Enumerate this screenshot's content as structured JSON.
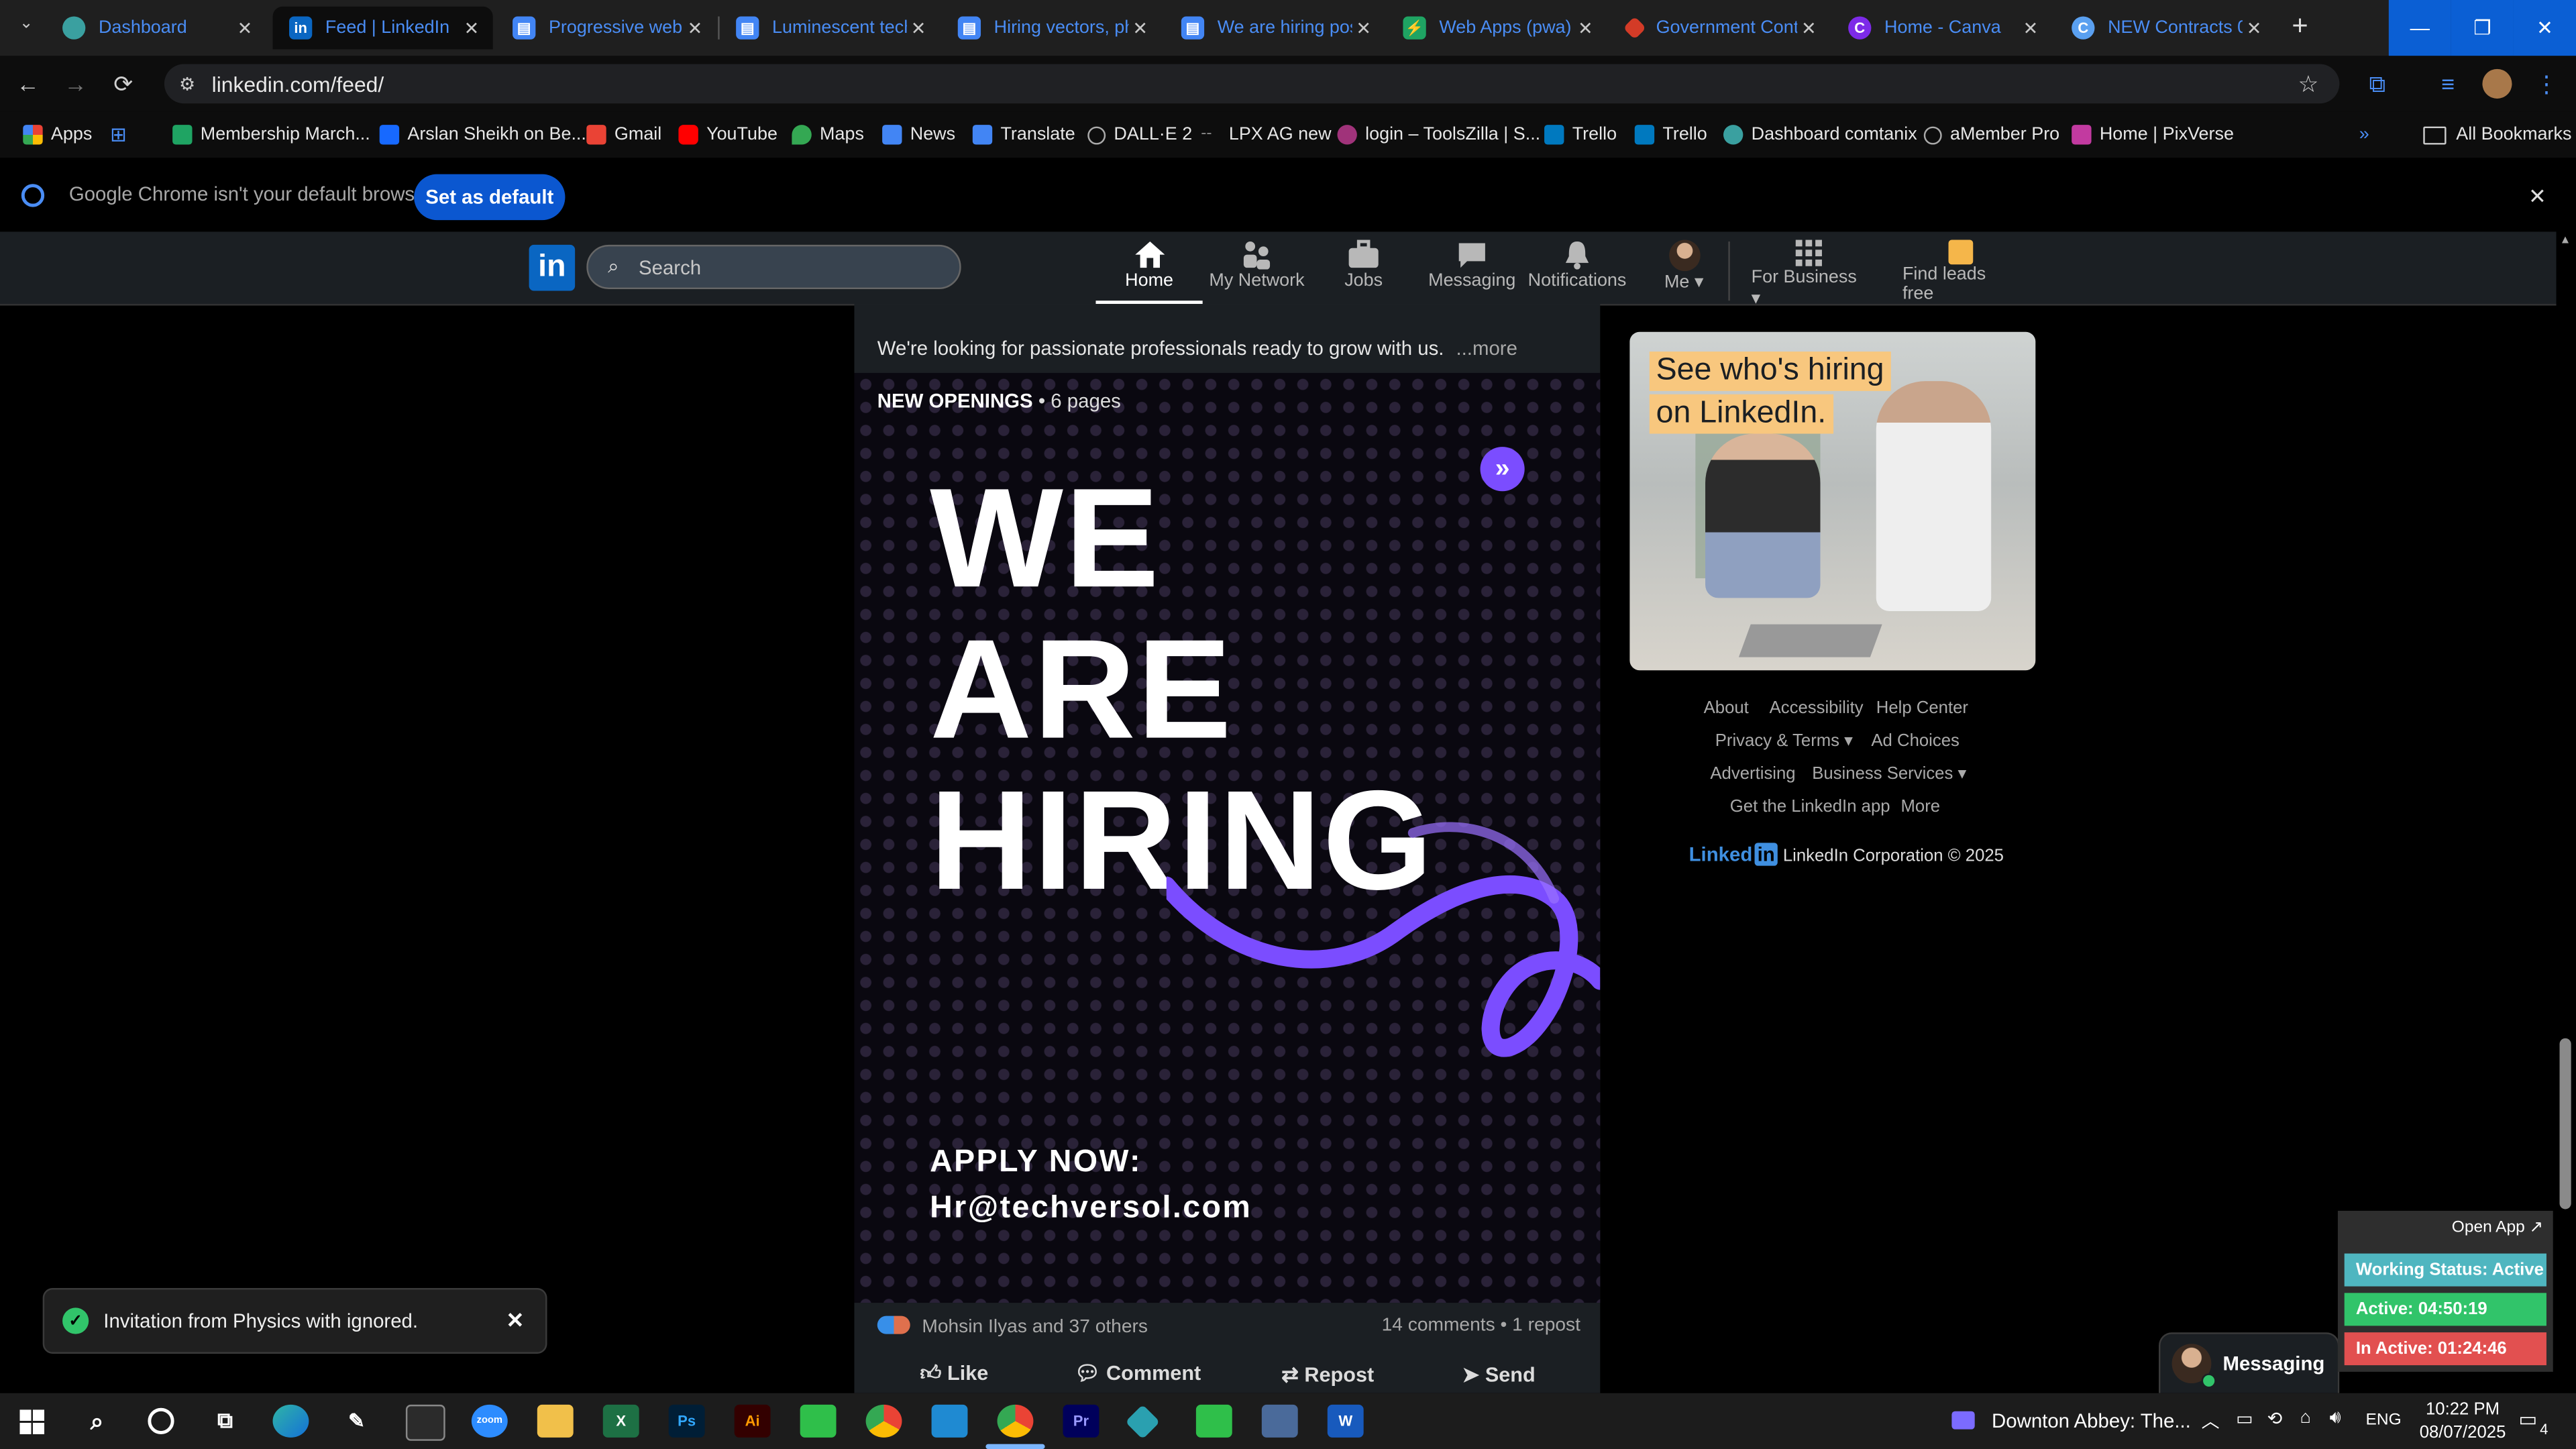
{
  "tabs": [
    {
      "title": "Dashboard",
      "icon": "dashboard-favicon",
      "color": "#3aa0a0"
    },
    {
      "title": "Feed | LinkedIn",
      "icon": "linkedin-favicon",
      "color": "#0a66c2"
    },
    {
      "title": "Progressive web a",
      "icon": "docs-favicon",
      "color": "#4285f4"
    },
    {
      "title": "Luminescent tech",
      "icon": "docs-favicon",
      "color": "#4285f4"
    },
    {
      "title": "Hiring vectors, ph",
      "icon": "docs-favicon",
      "color": "#4285f4"
    },
    {
      "title": "We are hiring pos",
      "icon": "docs-favicon",
      "color": "#4285f4"
    },
    {
      "title": "Web Apps (pwa) I",
      "icon": "sheets-favicon",
      "color": "#1fa463"
    },
    {
      "title": "Government Cont",
      "icon": "gov-favicon",
      "color": "#d33b27"
    },
    {
      "title": "Home - Canva",
      "icon": "canva-favicon",
      "color": "#7d2ae8"
    },
    {
      "title": "NEW Contracts 0",
      "icon": "contracts-favicon",
      "color": "#5aa0f0"
    }
  ],
  "address": "linkedin.com/feed/",
  "bookmarks": [
    {
      "label": "Apps",
      "color": "#e94235"
    },
    {
      "label": "Membership March...",
      "color": "#1fa463"
    },
    {
      "label": "Arslan Sheikh on Be...",
      "color": "#1769ff"
    },
    {
      "label": "Gmail",
      "color": "#ea4335"
    },
    {
      "label": "YouTube",
      "color": "#ff0000"
    },
    {
      "label": "Maps",
      "color": "#34a853"
    },
    {
      "label": "News",
      "color": "#4285f4"
    },
    {
      "label": "Translate",
      "color": "#4285f4"
    },
    {
      "label": "DALL·E 2",
      "color": "#999999"
    },
    {
      "label": "LPX AG new",
      "color": "#666666"
    },
    {
      "label": "login – ToolsZilla | S...",
      "color": "#a0337a"
    },
    {
      "label": "Trello",
      "color": "#0079bf"
    },
    {
      "label": "Trello",
      "color": "#0079bf"
    },
    {
      "label": "Dashboard comtanix",
      "color": "#3aa0a0"
    },
    {
      "label": "aMember Pro",
      "color": "#888888"
    },
    {
      "label": "Home | PixVerse",
      "color": "#c23aa0"
    }
  ],
  "all_bookmarks": "All Bookmarks",
  "infobar": {
    "message": "Google Chrome isn't your default browser",
    "button": "Set as default"
  },
  "linkedin": {
    "search_placeholder": "Search",
    "nav": [
      {
        "label": "Home",
        "icon": "home-icon"
      },
      {
        "label": "My Network",
        "icon": "network-icon"
      },
      {
        "label": "Jobs",
        "icon": "briefcase-icon"
      },
      {
        "label": "Messaging",
        "icon": "chat-icon"
      },
      {
        "label": "Notifications",
        "icon": "bell-icon"
      },
      {
        "label": "Me",
        "icon": "avatar"
      },
      {
        "label": "For Business",
        "icon": "grid-icon"
      },
      {
        "label": "Find leads free",
        "icon": "leads-icon"
      }
    ],
    "post": {
      "text": "We're looking for passionate professionals ready to grow with us.",
      "more": "...more",
      "doc_title": "NEW OPENINGS",
      "doc_pages": "• 6 pages",
      "headline": [
        "WE",
        "ARE",
        "HIRING"
      ],
      "apply": "APPLY NOW:",
      "email": "Hr@techversol.com",
      "reactions": "Mohsin Ilyas and 37 others",
      "comments": "14 comments • 1 repost",
      "actions": [
        "Like",
        "Comment",
        "Repost",
        "Send"
      ]
    },
    "ad": {
      "line1": "See who's hiring",
      "line2": "on LinkedIn."
    },
    "footer": {
      "about": "About",
      "accessibility": "Accessibility",
      "help": "Help Center",
      "privacy": "Privacy & Terms",
      "adchoices": "Ad Choices",
      "advertising": "Advertising",
      "business": "Business Services",
      "app": "Get the LinkedIn app",
      "more": "More",
      "brand": "Linked",
      "copyright": "LinkedIn Corporation © 2025"
    },
    "messaging": "Messaging"
  },
  "toast": {
    "message": "Invitation from Physics with ignored."
  },
  "tracker": {
    "open": "Open App ↗",
    "status": "Working Status: Active",
    "active": "Active: 04:50:19",
    "inactive": "In Active: 01:24:46"
  },
  "taskbar": {
    "media": "Downton Abbey: The...",
    "lang": "ENG",
    "time": "10:22 PM",
    "date": "08/07/2025",
    "notifications": "4"
  },
  "colors": {
    "accent": "#0a66c2",
    "purple": "#7b4dff",
    "active_green": "#31c46a",
    "inactive_red": "#e25050",
    "status_teal": "#4fb6c0"
  }
}
